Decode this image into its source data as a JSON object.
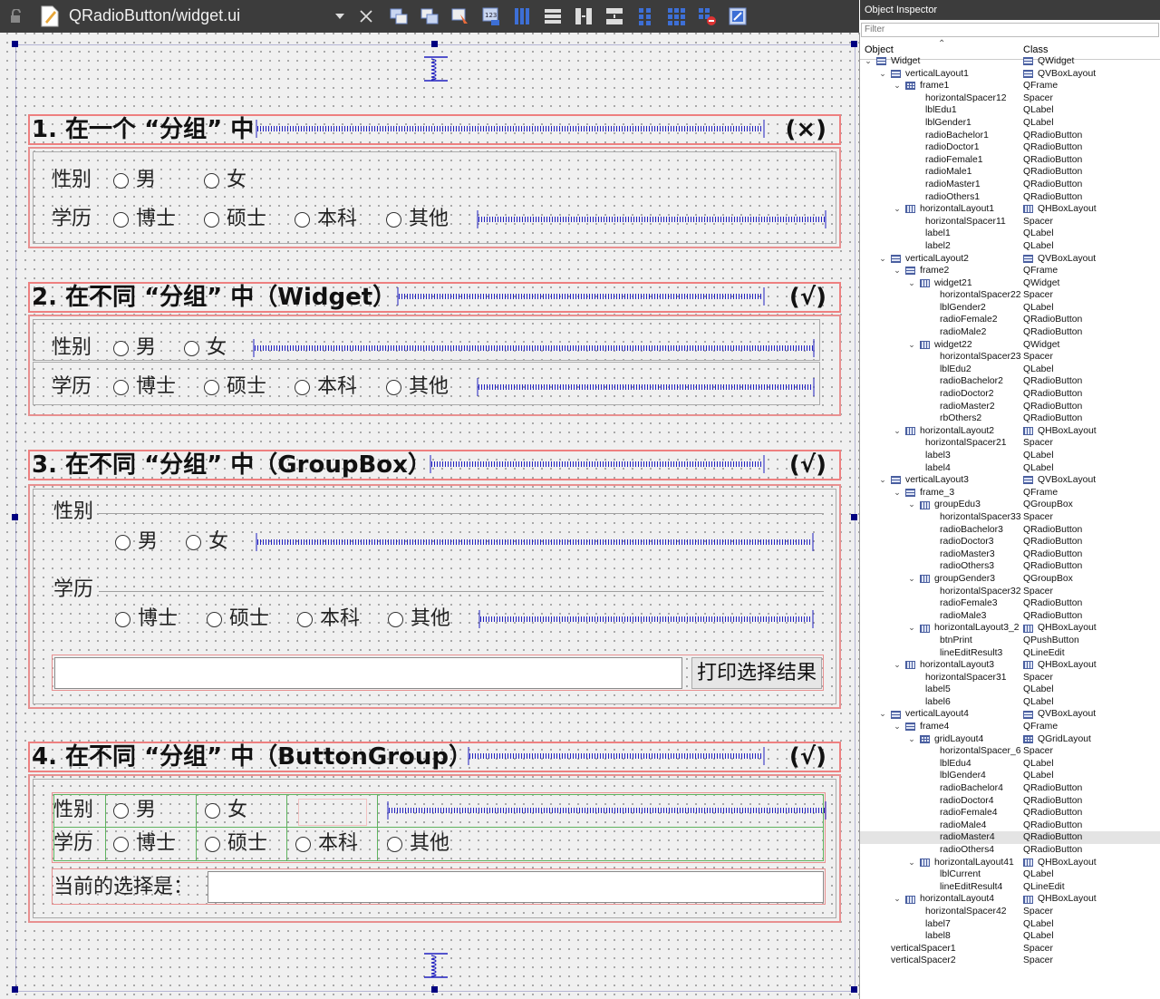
{
  "toolbar": {
    "filename": "QRadioButton/widget.ui"
  },
  "sections": [
    {
      "title": "1. 在一个 “分组” 中",
      "verdict": "(×)"
    },
    {
      "title": "2. 在不同 “分组” 中（Widget）",
      "verdict": "(√)"
    },
    {
      "title": "3. 在不同 “分组” 中（GroupBox）",
      "verdict": "(√)"
    },
    {
      "title": "4. 在不同 “分组” 中（ButtonGroup）",
      "verdict": "(√)"
    }
  ],
  "labels": {
    "gender": "性别",
    "education": "学历",
    "current": "当前的选择是："
  },
  "options": {
    "male": "男",
    "female": "女",
    "doctor": "博士",
    "master": "硕士",
    "bachelor": "本科",
    "others": "其他"
  },
  "print_button": "打印选择结果",
  "inspector": {
    "title": "Object Inspector",
    "filter_placeholder": "Filter",
    "col_object": "Object",
    "col_class": "Class",
    "rows": [
      {
        "n": "Widget",
        "c": "QWidget",
        "lvl": 0,
        "exp": true,
        "icon": "v",
        "cicon": "v"
      },
      {
        "n": "verticalLayout1",
        "c": "QVBoxLayout",
        "lvl": 1,
        "exp": true,
        "icon": "v",
        "cicon": "v"
      },
      {
        "n": "frame1",
        "c": "QFrame",
        "lvl": 2,
        "exp": true,
        "icon": "g"
      },
      {
        "n": "horizontalSpacer12",
        "c": "Spacer",
        "lvl": 3
      },
      {
        "n": "lblEdu1",
        "c": "QLabel",
        "lvl": 3
      },
      {
        "n": "lblGender1",
        "c": "QLabel",
        "lvl": 3
      },
      {
        "n": "radioBachelor1",
        "c": "QRadioButton",
        "lvl": 3
      },
      {
        "n": "radioDoctor1",
        "c": "QRadioButton",
        "lvl": 3
      },
      {
        "n": "radioFemale1",
        "c": "QRadioButton",
        "lvl": 3
      },
      {
        "n": "radioMale1",
        "c": "QRadioButton",
        "lvl": 3
      },
      {
        "n": "radioMaster1",
        "c": "QRadioButton",
        "lvl": 3
      },
      {
        "n": "radioOthers1",
        "c": "QRadioButton",
        "lvl": 3
      },
      {
        "n": "horizontalLayout1",
        "c": "QHBoxLayout",
        "lvl": 2,
        "exp": true,
        "icon": "h",
        "cicon": "h"
      },
      {
        "n": "horizontalSpacer11",
        "c": "Spacer",
        "lvl": 3
      },
      {
        "n": "label1",
        "c": "QLabel",
        "lvl": 3
      },
      {
        "n": "label2",
        "c": "QLabel",
        "lvl": 3
      },
      {
        "n": "verticalLayout2",
        "c": "QVBoxLayout",
        "lvl": 1,
        "exp": true,
        "icon": "v",
        "cicon": "v"
      },
      {
        "n": "frame2",
        "c": "QFrame",
        "lvl": 2,
        "exp": true,
        "icon": "v"
      },
      {
        "n": "widget21",
        "c": "QWidget",
        "lvl": 3,
        "exp": true,
        "icon": "h"
      },
      {
        "n": "horizontalSpacer22",
        "c": "Spacer",
        "lvl": 4
      },
      {
        "n": "lblGender2",
        "c": "QLabel",
        "lvl": 4
      },
      {
        "n": "radioFemale2",
        "c": "QRadioButton",
        "lvl": 4
      },
      {
        "n": "radioMale2",
        "c": "QRadioButton",
        "lvl": 4
      },
      {
        "n": "widget22",
        "c": "QWidget",
        "lvl": 3,
        "exp": true,
        "icon": "h"
      },
      {
        "n": "horizontalSpacer23",
        "c": "Spacer",
        "lvl": 4
      },
      {
        "n": "lblEdu2",
        "c": "QLabel",
        "lvl": 4
      },
      {
        "n": "radioBachelor2",
        "c": "QRadioButton",
        "lvl": 4
      },
      {
        "n": "radioDoctor2",
        "c": "QRadioButton",
        "lvl": 4
      },
      {
        "n": "radioMaster2",
        "c": "QRadioButton",
        "lvl": 4
      },
      {
        "n": "rbOthers2",
        "c": "QRadioButton",
        "lvl": 4
      },
      {
        "n": "horizontalLayout2",
        "c": "QHBoxLayout",
        "lvl": 2,
        "exp": true,
        "icon": "h",
        "cicon": "h"
      },
      {
        "n": "horizontalSpacer21",
        "c": "Spacer",
        "lvl": 3
      },
      {
        "n": "label3",
        "c": "QLabel",
        "lvl": 3
      },
      {
        "n": "label4",
        "c": "QLabel",
        "lvl": 3
      },
      {
        "n": "verticalLayout3",
        "c": "QVBoxLayout",
        "lvl": 1,
        "exp": true,
        "icon": "v",
        "cicon": "v"
      },
      {
        "n": "frame_3",
        "c": "QFrame",
        "lvl": 2,
        "exp": true,
        "icon": "v"
      },
      {
        "n": "groupEdu3",
        "c": "QGroupBox",
        "lvl": 3,
        "exp": true,
        "icon": "h"
      },
      {
        "n": "horizontalSpacer33",
        "c": "Spacer",
        "lvl": 4
      },
      {
        "n": "radioBachelor3",
        "c": "QRadioButton",
        "lvl": 4
      },
      {
        "n": "radioDoctor3",
        "c": "QRadioButton",
        "lvl": 4
      },
      {
        "n": "radioMaster3",
        "c": "QRadioButton",
        "lvl": 4
      },
      {
        "n": "radioOthers3",
        "c": "QRadioButton",
        "lvl": 4
      },
      {
        "n": "groupGender3",
        "c": "QGroupBox",
        "lvl": 3,
        "exp": true,
        "icon": "h"
      },
      {
        "n": "horizontalSpacer32",
        "c": "Spacer",
        "lvl": 4
      },
      {
        "n": "radioFemale3",
        "c": "QRadioButton",
        "lvl": 4
      },
      {
        "n": "radioMale3",
        "c": "QRadioButton",
        "lvl": 4
      },
      {
        "n": "horizontalLayout3_2",
        "c": "QHBoxLayout",
        "lvl": 3,
        "exp": true,
        "icon": "h",
        "cicon": "h"
      },
      {
        "n": "btnPrint",
        "c": "QPushButton",
        "lvl": 4
      },
      {
        "n": "lineEditResult3",
        "c": "QLineEdit",
        "lvl": 4
      },
      {
        "n": "horizontalLayout3",
        "c": "QHBoxLayout",
        "lvl": 2,
        "exp": true,
        "icon": "h",
        "cicon": "h"
      },
      {
        "n": "horizontalSpacer31",
        "c": "Spacer",
        "lvl": 3
      },
      {
        "n": "label5",
        "c": "QLabel",
        "lvl": 3
      },
      {
        "n": "label6",
        "c": "QLabel",
        "lvl": 3
      },
      {
        "n": "verticalLayout4",
        "c": "QVBoxLayout",
        "lvl": 1,
        "exp": true,
        "icon": "v",
        "cicon": "v"
      },
      {
        "n": "frame4",
        "c": "QFrame",
        "lvl": 2,
        "exp": true,
        "icon": "v"
      },
      {
        "n": "gridLayout4",
        "c": "QGridLayout",
        "lvl": 3,
        "exp": true,
        "icon": "g",
        "cicon": "g"
      },
      {
        "n": "horizontalSpacer_6",
        "c": "Spacer",
        "lvl": 4
      },
      {
        "n": "lblEdu4",
        "c": "QLabel",
        "lvl": 4
      },
      {
        "n": "lblGender4",
        "c": "QLabel",
        "lvl": 4
      },
      {
        "n": "radioBachelor4",
        "c": "QRadioButton",
        "lvl": 4
      },
      {
        "n": "radioDoctor4",
        "c": "QRadioButton",
        "lvl": 4
      },
      {
        "n": "radioFemale4",
        "c": "QRadioButton",
        "lvl": 4
      },
      {
        "n": "radioMale4",
        "c": "QRadioButton",
        "lvl": 4
      },
      {
        "n": "radioMaster4",
        "c": "QRadioButton",
        "lvl": 4,
        "sel": true
      },
      {
        "n": "radioOthers4",
        "c": "QRadioButton",
        "lvl": 4
      },
      {
        "n": "horizontalLayout41",
        "c": "QHBoxLayout",
        "lvl": 3,
        "exp": true,
        "icon": "h",
        "cicon": "h"
      },
      {
        "n": "lblCurrent",
        "c": "QLabel",
        "lvl": 4
      },
      {
        "n": "lineEditResult4",
        "c": "QLineEdit",
        "lvl": 4
      },
      {
        "n": "horizontalLayout4",
        "c": "QHBoxLayout",
        "lvl": 2,
        "exp": true,
        "icon": "h",
        "cicon": "h"
      },
      {
        "n": "horizontalSpacer42",
        "c": "Spacer",
        "lvl": 3
      },
      {
        "n": "label7",
        "c": "QLabel",
        "lvl": 3
      },
      {
        "n": "label8",
        "c": "QLabel",
        "lvl": 3
      },
      {
        "n": "verticalSpacer1",
        "c": "Spacer",
        "lvl": 1
      },
      {
        "n": "verticalSpacer2",
        "c": "Spacer",
        "lvl": 1
      }
    ]
  }
}
